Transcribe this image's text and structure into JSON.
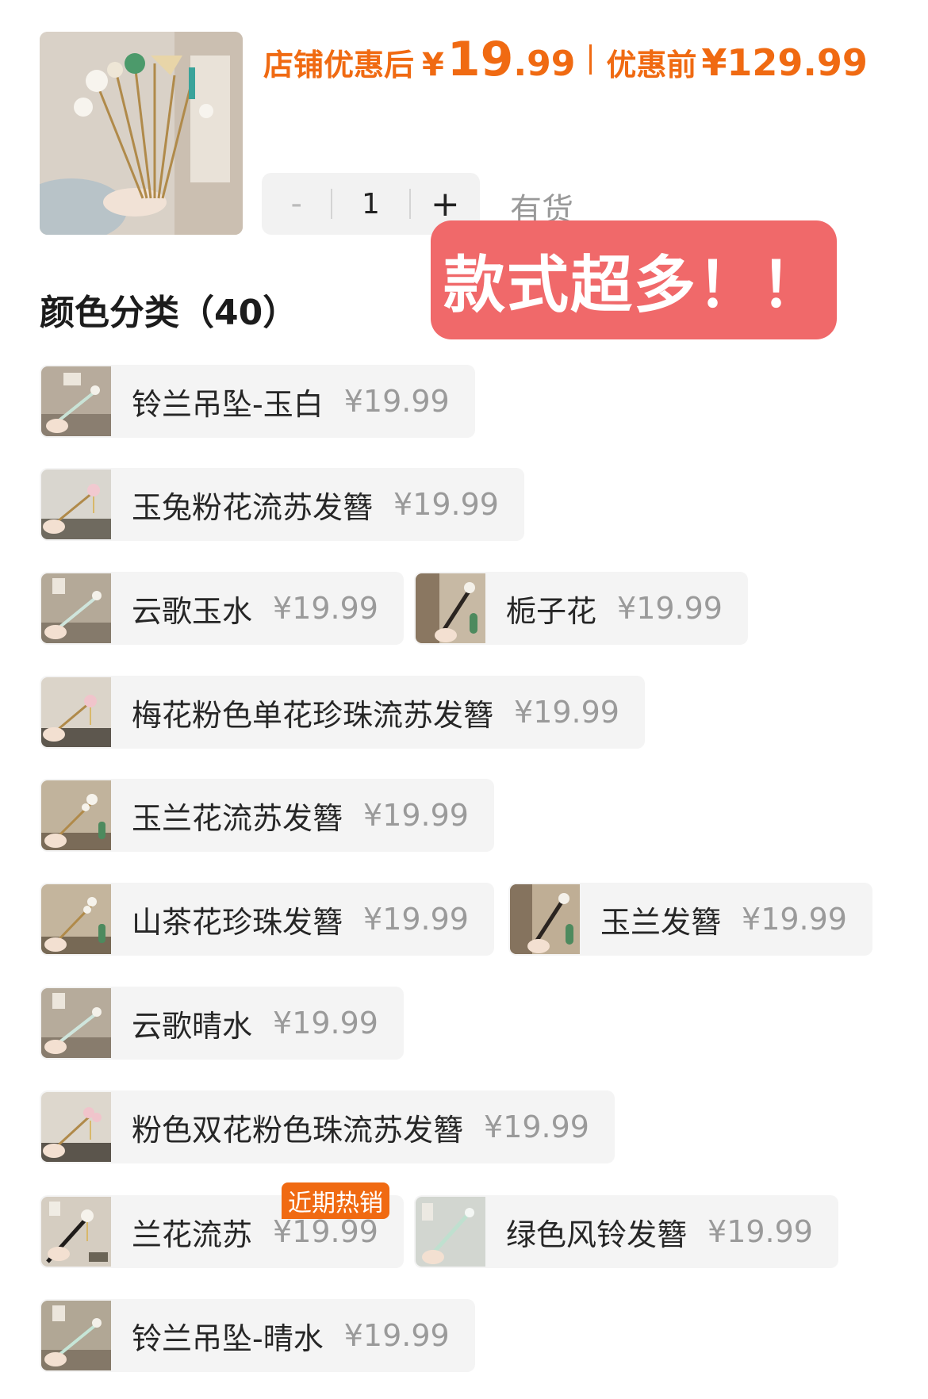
{
  "product": {
    "discount_label": "店铺优惠后",
    "discount_currency": "¥",
    "discount_int": "19",
    "discount_dec": ".99",
    "orig_label": "优惠前",
    "orig_price": "¥129.99"
  },
  "quantity": {
    "minus": "-",
    "value": "1",
    "plus": "+"
  },
  "stock_text": "有货",
  "overlay_text": "款式超多！！",
  "section": {
    "title": "颜色分类（40）"
  },
  "variants": [
    {
      "name": "铃兰吊坠-玉白",
      "price": "¥19.99"
    },
    {
      "name": "玉兔粉花流苏发簪",
      "price": "¥19.99"
    },
    {
      "name": "云歌玉水",
      "price": "¥19.99"
    },
    {
      "name": "栀子花",
      "price": "¥19.99"
    },
    {
      "name": "梅花粉色单花珍珠流苏发簪",
      "price": "¥19.99"
    },
    {
      "name": "玉兰花流苏发簪",
      "price": "¥19.99"
    },
    {
      "name": "山茶花珍珠发簪",
      "price": "¥19.99"
    },
    {
      "name": "玉兰发簪",
      "price": "¥19.99"
    },
    {
      "name": "云歌晴水",
      "price": "¥19.99"
    },
    {
      "name": "粉色双花粉色珠流苏发簪",
      "price": "¥19.99"
    },
    {
      "name": "兰花流苏",
      "price": "¥19.99",
      "badge": "近期热销"
    },
    {
      "name": "绿色风铃发簪",
      "price": "¥19.99"
    },
    {
      "name": "铃兰吊坠-晴水",
      "price": "¥19.99"
    }
  ]
}
